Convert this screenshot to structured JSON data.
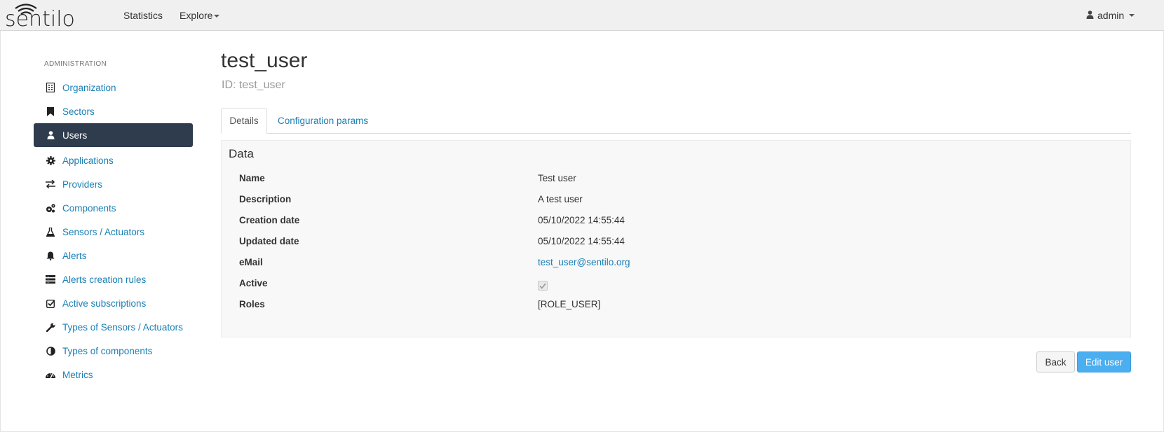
{
  "navbar": {
    "brand": "sentilo",
    "links": [
      {
        "label": "Statistics"
      },
      {
        "label": "Explore"
      }
    ],
    "user": "admin",
    "icons": {
      "user": "user-icon",
      "caret": "caret-down-icon"
    }
  },
  "sidebar": {
    "heading": "ADMINISTRATION",
    "items": [
      {
        "label": "Organization",
        "icon": "building-icon"
      },
      {
        "label": "Sectors",
        "icon": "bookmark-icon"
      },
      {
        "label": "Users",
        "icon": "user-icon",
        "active": true
      },
      {
        "label": "Applications",
        "icon": "gear-icon"
      },
      {
        "label": "Providers",
        "icon": "exchange-icon"
      },
      {
        "label": "Components",
        "icon": "cogs-icon"
      },
      {
        "label": "Sensors / Actuators",
        "icon": "flask-icon"
      },
      {
        "label": "Alerts",
        "icon": "bell-icon"
      },
      {
        "label": "Alerts creation rules",
        "icon": "list-icon"
      },
      {
        "label": "Active subscriptions",
        "icon": "check-square-icon"
      },
      {
        "label": "Types of Sensors / Actuators",
        "icon": "wrench-icon"
      },
      {
        "label": "Types of components",
        "icon": "half-circle-icon"
      },
      {
        "label": "Metrics",
        "icon": "dashboard-icon"
      }
    ]
  },
  "main": {
    "title": "test_user",
    "subtitle": "ID: test_user",
    "tabs": [
      {
        "label": "Details",
        "active": true
      },
      {
        "label": "Configuration params"
      }
    ],
    "panel": {
      "title": "Data",
      "rows": [
        {
          "label": "Name",
          "value": "Test user"
        },
        {
          "label": "Description",
          "value": "A test user"
        },
        {
          "label": "Creation date",
          "value": "05/10/2022 14:55:44"
        },
        {
          "label": "Updated date",
          "value": "05/10/2022 14:55:44"
        },
        {
          "label": "eMail",
          "value": "test_user@sentilo.org"
        },
        {
          "label": "Active",
          "value": "checked"
        },
        {
          "label": "Roles",
          "value": "[ROLE_USER]"
        }
      ]
    },
    "buttons": {
      "back": "Back",
      "edit": "Edit user"
    }
  },
  "colors": {
    "link": "#1a7fb5",
    "active_bg": "#2e3c4e",
    "primary": "#4aaef0"
  }
}
